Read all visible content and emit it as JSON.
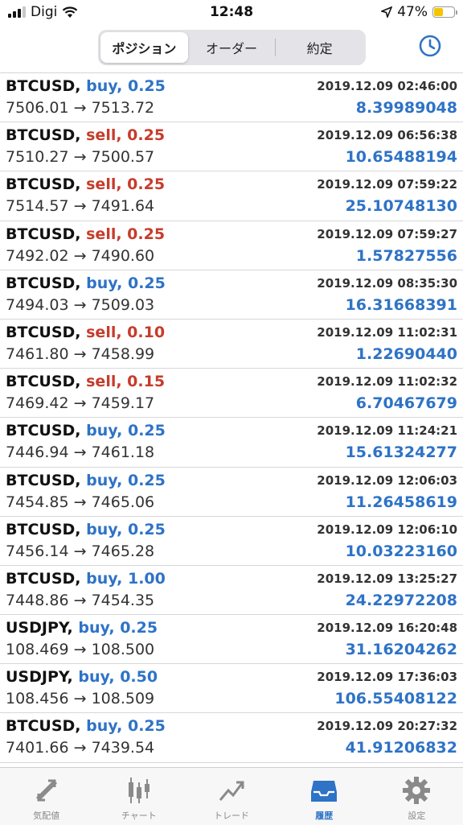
{
  "status_bar": {
    "carrier": "Digi",
    "time": "12:48",
    "battery": "47%",
    "battery_level": 0.47
  },
  "header": {
    "tabs": [
      {
        "label": "ポジション",
        "active": true
      },
      {
        "label": "オーダー",
        "active": false
      },
      {
        "label": "約定",
        "active": false
      }
    ],
    "history_icon": "clock-icon"
  },
  "deals": [
    {
      "symbol": "BTCUSD,",
      "side": "buy",
      "side_text": "buy, 0.25",
      "time": "2019.12.09 02:46:00",
      "prices": "7506.01 → 7513.72",
      "profit": "8.39989048"
    },
    {
      "symbol": "BTCUSD,",
      "side": "sell",
      "side_text": "sell, 0.25",
      "time": "2019.12.09 06:56:38",
      "prices": "7510.27 → 7500.57",
      "profit": "10.65488194"
    },
    {
      "symbol": "BTCUSD,",
      "side": "sell",
      "side_text": "sell, 0.25",
      "time": "2019.12.09 07:59:22",
      "prices": "7514.57 → 7491.64",
      "profit": "25.10748130"
    },
    {
      "symbol": "BTCUSD,",
      "side": "sell",
      "side_text": "sell, 0.25",
      "time": "2019.12.09 07:59:27",
      "prices": "7492.02 → 7490.60",
      "profit": "1.57827556"
    },
    {
      "symbol": "BTCUSD,",
      "side": "buy",
      "side_text": "buy, 0.25",
      "time": "2019.12.09 08:35:30",
      "prices": "7494.03 → 7509.03",
      "profit": "16.31668391"
    },
    {
      "symbol": "BTCUSD,",
      "side": "sell",
      "side_text": "sell, 0.10",
      "time": "2019.12.09 11:02:31",
      "prices": "7461.80 → 7458.99",
      "profit": "1.22690440"
    },
    {
      "symbol": "BTCUSD,",
      "side": "sell",
      "side_text": "sell, 0.15",
      "time": "2019.12.09 11:02:32",
      "prices": "7469.42 → 7459.17",
      "profit": "6.70467679"
    },
    {
      "symbol": "BTCUSD,",
      "side": "buy",
      "side_text": "buy, 0.25",
      "time": "2019.12.09 11:24:21",
      "prices": "7446.94 → 7461.18",
      "profit": "15.61324277"
    },
    {
      "symbol": "BTCUSD,",
      "side": "buy",
      "side_text": "buy, 0.25",
      "time": "2019.12.09 12:06:03",
      "prices": "7454.85 → 7465.06",
      "profit": "11.26458619"
    },
    {
      "symbol": "BTCUSD,",
      "side": "buy",
      "side_text": "buy, 0.25",
      "time": "2019.12.09 12:06:10",
      "prices": "7456.14 → 7465.28",
      "profit": "10.03223160"
    },
    {
      "symbol": "BTCUSD,",
      "side": "buy",
      "side_text": "buy, 1.00",
      "time": "2019.12.09 13:25:27",
      "prices": "7448.86 → 7454.35",
      "profit": "24.22972208"
    },
    {
      "symbol": "USDJPY,",
      "side": "buy",
      "side_text": "buy, 0.25",
      "time": "2019.12.09 16:20:48",
      "prices": "108.469 → 108.500",
      "profit": "31.16204262"
    },
    {
      "symbol": "USDJPY,",
      "side": "buy",
      "side_text": "buy, 0.50",
      "time": "2019.12.09 17:36:03",
      "prices": "108.456 → 108.509",
      "profit": "106.55408122"
    },
    {
      "symbol": "BTCUSD,",
      "side": "buy",
      "side_text": "buy, 0.25",
      "time": "2019.12.09 20:27:32",
      "prices": "7401.66 → 7439.54",
      "profit": "41.91206832"
    }
  ],
  "tab_bar": [
    {
      "label": "気配値",
      "icon": "quotes-icon",
      "active": false
    },
    {
      "label": "チャート",
      "icon": "chart-candles-icon",
      "active": false
    },
    {
      "label": "トレード",
      "icon": "trade-icon",
      "active": false
    },
    {
      "label": "履歴",
      "icon": "history-inbox-icon",
      "active": true
    },
    {
      "label": "設定",
      "icon": "gear-icon",
      "active": false
    }
  ],
  "colors": {
    "accent": "#2e73c6",
    "sell": "#c63c2b",
    "battery": "#f5c400"
  }
}
